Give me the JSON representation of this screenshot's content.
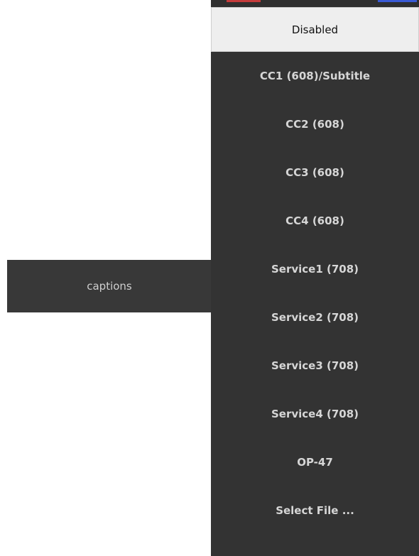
{
  "captions_button": {
    "label": "captions"
  },
  "menu": {
    "items": [
      {
        "label": "Disabled",
        "selected": true
      },
      {
        "label": "CC1 (608)/Subtitle",
        "selected": false
      },
      {
        "label": "CC2 (608)",
        "selected": false
      },
      {
        "label": "CC3 (608)",
        "selected": false
      },
      {
        "label": "CC4 (608)",
        "selected": false
      },
      {
        "label": "Service1 (708)",
        "selected": false
      },
      {
        "label": "Service2 (708)",
        "selected": false
      },
      {
        "label": "Service3 (708)",
        "selected": false
      },
      {
        "label": "Service4 (708)",
        "selected": false
      },
      {
        "label": "OP-47",
        "selected": false
      },
      {
        "label": "Select File ...",
        "selected": false
      }
    ]
  },
  "colors": {
    "menu_background": "#333333",
    "selected_background": "#eeeeee",
    "button_background": "#383838",
    "text_color": "#d6d6d6"
  }
}
